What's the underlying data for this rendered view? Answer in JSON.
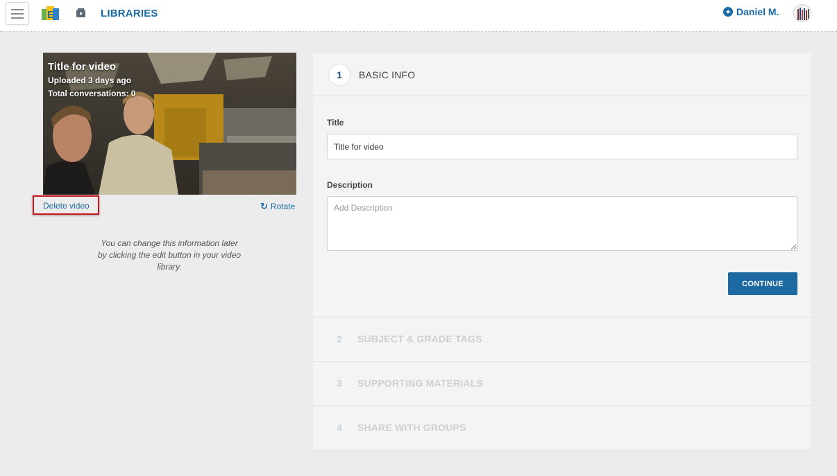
{
  "header": {
    "title": "LIBRARIES",
    "user_name": "Daniel M.",
    "icons": [
      "menu-icon",
      "app-logo",
      "library-icon",
      "star-icon",
      "avatar"
    ]
  },
  "video": {
    "title": "Title for video",
    "uploaded": "Uploaded 3 days ago",
    "conversations": "Total conversations: 0",
    "delete_label": "Delete video",
    "rotate_label": "Rotate",
    "help_text": "You can change this information later by clicking the edit button in your video library."
  },
  "steps": [
    {
      "number": "1",
      "label": "BASIC INFO"
    },
    {
      "number": "2",
      "label": "SUBJECT & GRADE TAGS"
    },
    {
      "number": "3",
      "label": "SUPPORTING MATERIALS"
    },
    {
      "number": "4",
      "label": "SHARE WITH GROUPS"
    }
  ],
  "form": {
    "title_label": "Title",
    "title_value": "Title for video",
    "description_label": "Description",
    "description_placeholder": "Add Description",
    "continue_label": "CONTINUE"
  },
  "colors": {
    "accent": "#1a6aa3",
    "button": "#1c6aa1",
    "highlight_border": "#c8141b",
    "background": "#ececec"
  }
}
